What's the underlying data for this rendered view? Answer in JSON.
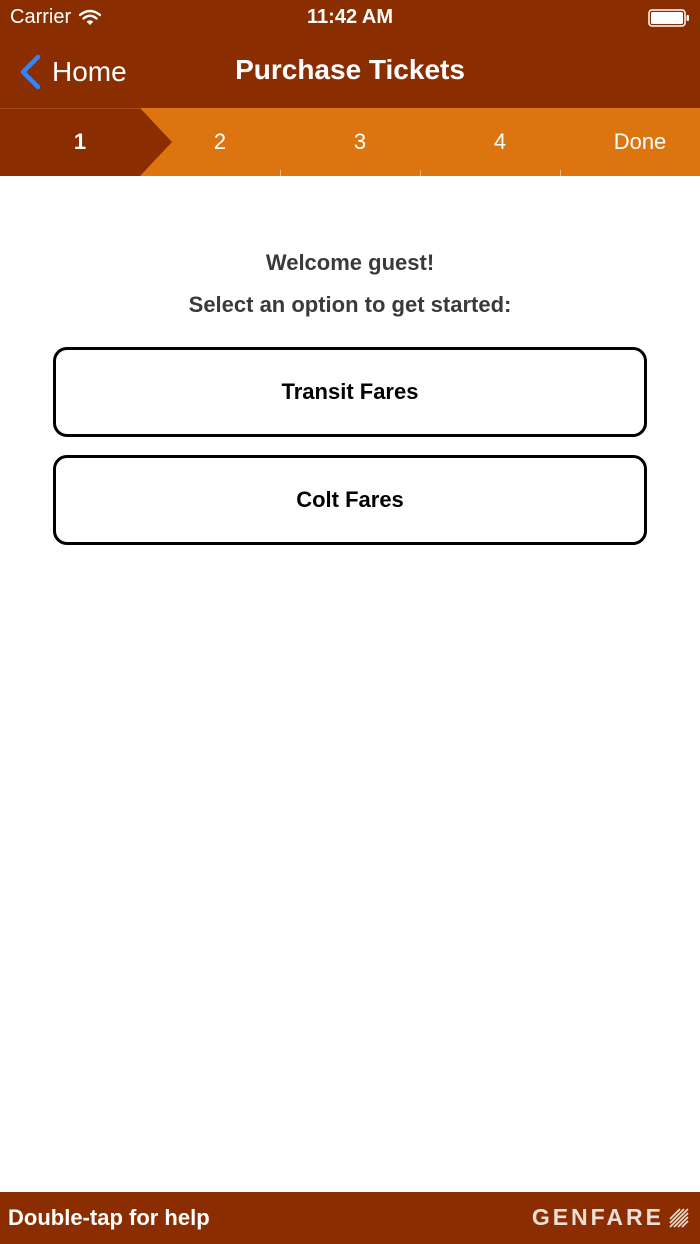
{
  "status_bar": {
    "carrier": "Carrier",
    "time": "11:42 AM"
  },
  "nav": {
    "back_label": "Home",
    "title": "Purchase Tickets"
  },
  "steps": [
    {
      "label": "1",
      "active": true
    },
    {
      "label": "2",
      "active": false
    },
    {
      "label": "3",
      "active": false
    },
    {
      "label": "4",
      "active": false
    },
    {
      "label": "Done",
      "active": false
    }
  ],
  "main": {
    "welcome": "Welcome guest!",
    "prompt": "Select an option to get started:",
    "options": [
      {
        "label": "Transit Fares"
      },
      {
        "label": "Colt Fares"
      }
    ]
  },
  "footer": {
    "help": "Double-tap for help",
    "brand": "GENFARE"
  },
  "colors": {
    "header": "#8a2e02",
    "steps_bar": "#dc7510",
    "back_chevron": "#2f86ff"
  },
  "icons": {
    "wifi": "wifi-icon",
    "battery": "battery-icon",
    "back": "chevron-left-icon",
    "brand_mark": "genfare-logo-icon"
  }
}
